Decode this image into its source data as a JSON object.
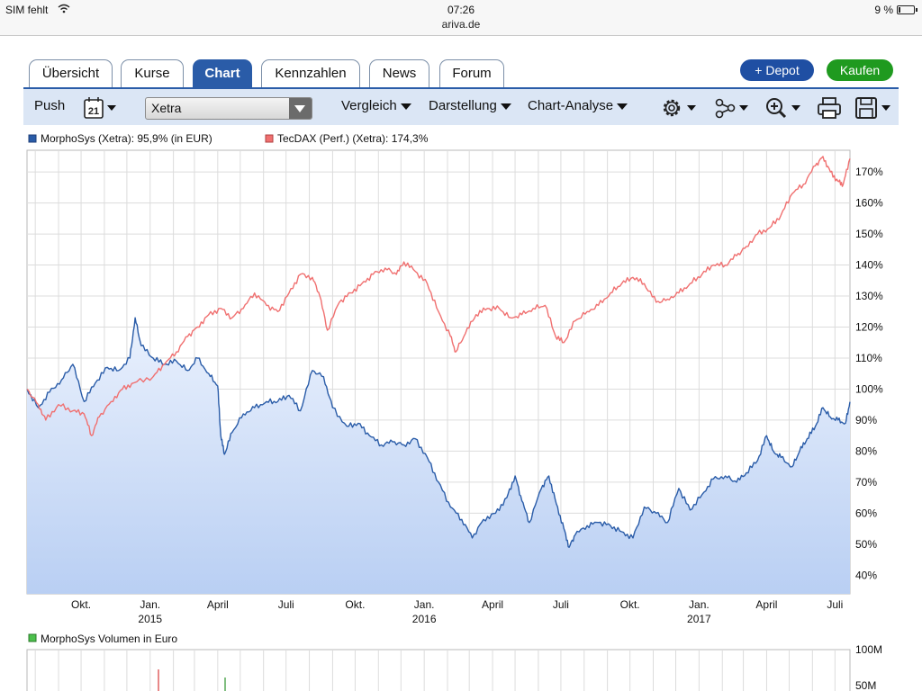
{
  "status_bar": {
    "carrier": "SIM fehlt",
    "time": "07:26",
    "url": "ariva.de",
    "battery_pct": "9 %",
    "battery_level": 0.09
  },
  "tabs": [
    {
      "label": "Übersicht",
      "active": false
    },
    {
      "label": "Kurse",
      "active": false
    },
    {
      "label": "Chart",
      "active": true
    },
    {
      "label": "Kennzahlen",
      "active": false
    },
    {
      "label": "News",
      "active": false
    },
    {
      "label": "Forum",
      "active": false
    }
  ],
  "actions": {
    "depot": "+ Depot",
    "kaufen": "Kaufen"
  },
  "toolbar": {
    "push": "Push",
    "calendar_day": "21",
    "exchange_select": "Xetra",
    "vergleich": "Vergleich",
    "darstellung": "Darstellung",
    "chart_analyse": "Chart-Analyse",
    "icons": [
      "gear-icon",
      "share-icon",
      "zoom-icon",
      "print-icon",
      "save-icon"
    ]
  },
  "chart_data": {
    "type": "area",
    "legend": [
      {
        "label": "MorphoSys (Xetra): 95,9% (in EUR)",
        "color": "#2a5ca8"
      },
      {
        "label": "TecDAX (Perf.) (Xetra): 174,3%",
        "color": "#f07070"
      }
    ],
    "y_ticks": [
      "170%",
      "160%",
      "150%",
      "140%",
      "130%",
      "120%",
      "110%",
      "100%",
      "90%",
      "80%",
      "70%",
      "60%",
      "50%",
      "40%"
    ],
    "ylim": [
      34,
      177
    ],
    "x_months": [
      {
        "label": "Okt.",
        "year": ""
      },
      {
        "label": "Jan.",
        "year": "2015"
      },
      {
        "label": "April",
        "year": ""
      },
      {
        "label": "Juli",
        "year": ""
      },
      {
        "label": "Okt.",
        "year": ""
      },
      {
        "label": "Jan.",
        "year": "2016"
      },
      {
        "label": "April",
        "year": ""
      },
      {
        "label": "Juli",
        "year": ""
      },
      {
        "label": "Okt.",
        "year": ""
      },
      {
        "label": "Jan.",
        "year": "2017"
      },
      {
        "label": "April",
        "year": ""
      },
      {
        "label": "Juli",
        "year": ""
      }
    ],
    "x_range": [
      "2014-07-21",
      "2017-07-21"
    ],
    "series": [
      {
        "name": "MorphoSys (Xetra)",
        "color": "#2a5ca8",
        "fill": true,
        "points": [
          [
            "2014-07-21",
            100
          ],
          [
            "2014-08-05",
            94
          ],
          [
            "2014-08-20",
            99
          ],
          [
            "2014-09-05",
            103
          ],
          [
            "2014-09-20",
            108
          ],
          [
            "2014-10-05",
            96
          ],
          [
            "2014-10-20",
            102
          ],
          [
            "2014-11-05",
            107
          ],
          [
            "2014-11-20",
            106
          ],
          [
            "2014-12-05",
            110
          ],
          [
            "2014-12-12",
            123
          ],
          [
            "2014-12-20",
            114
          ],
          [
            "2015-01-05",
            110
          ],
          [
            "2015-01-20",
            108
          ],
          [
            "2015-02-05",
            109
          ],
          [
            "2015-02-20",
            106
          ],
          [
            "2015-03-05",
            110
          ],
          [
            "2015-03-20",
            105
          ],
          [
            "2015-04-01",
            101
          ],
          [
            "2015-04-05",
            85
          ],
          [
            "2015-04-10",
            79
          ],
          [
            "2015-04-20",
            86
          ],
          [
            "2015-05-05",
            92
          ],
          [
            "2015-05-20",
            94
          ],
          [
            "2015-06-05",
            96
          ],
          [
            "2015-06-20",
            96
          ],
          [
            "2015-07-05",
            98
          ],
          [
            "2015-07-20",
            93
          ],
          [
            "2015-08-05",
            106
          ],
          [
            "2015-08-20",
            104
          ],
          [
            "2015-09-01",
            94
          ],
          [
            "2015-09-20",
            88
          ],
          [
            "2015-10-05",
            89
          ],
          [
            "2015-10-20",
            85
          ],
          [
            "2015-11-05",
            82
          ],
          [
            "2015-11-20",
            83
          ],
          [
            "2015-12-05",
            82
          ],
          [
            "2015-12-20",
            84
          ],
          [
            "2016-01-05",
            78
          ],
          [
            "2016-01-20",
            70
          ],
          [
            "2016-02-05",
            62
          ],
          [
            "2016-02-20",
            58
          ],
          [
            "2016-03-05",
            52
          ],
          [
            "2016-03-20",
            58
          ],
          [
            "2016-04-05",
            60
          ],
          [
            "2016-04-20",
            65
          ],
          [
            "2016-05-01",
            72
          ],
          [
            "2016-05-10",
            64
          ],
          [
            "2016-05-20",
            57
          ],
          [
            "2016-06-05",
            68
          ],
          [
            "2016-06-15",
            72
          ],
          [
            "2016-06-25",
            63
          ],
          [
            "2016-07-05",
            55
          ],
          [
            "2016-07-12",
            49
          ],
          [
            "2016-07-20",
            53
          ],
          [
            "2016-08-05",
            56
          ],
          [
            "2016-08-20",
            57
          ],
          [
            "2016-09-05",
            56
          ],
          [
            "2016-09-20",
            54
          ],
          [
            "2016-10-05",
            52
          ],
          [
            "2016-10-20",
            62
          ],
          [
            "2016-11-05",
            60
          ],
          [
            "2016-11-20",
            57
          ],
          [
            "2016-12-05",
            68
          ],
          [
            "2016-12-20",
            61
          ],
          [
            "2017-01-05",
            66
          ],
          [
            "2017-01-20",
            71
          ],
          [
            "2017-02-05",
            72
          ],
          [
            "2017-02-20",
            70
          ],
          [
            "2017-03-05",
            73
          ],
          [
            "2017-03-20",
            77
          ],
          [
            "2017-04-01",
            85
          ],
          [
            "2017-04-10",
            80
          ],
          [
            "2017-04-20",
            78
          ],
          [
            "2017-05-05",
            75
          ],
          [
            "2017-05-15",
            80
          ],
          [
            "2017-05-25",
            84
          ],
          [
            "2017-06-05",
            88
          ],
          [
            "2017-06-15",
            94
          ],
          [
            "2017-06-25",
            91
          ],
          [
            "2017-07-05",
            90
          ],
          [
            "2017-07-15",
            89
          ],
          [
            "2017-07-21",
            95.9
          ]
        ]
      },
      {
        "name": "TecDAX (Perf.) (Xetra)",
        "color": "#f07070",
        "fill": false,
        "points": [
          [
            "2014-07-21",
            100
          ],
          [
            "2014-08-05",
            95
          ],
          [
            "2014-08-15",
            90
          ],
          [
            "2014-09-01",
            95
          ],
          [
            "2014-09-20",
            93
          ],
          [
            "2014-10-05",
            92
          ],
          [
            "2014-10-15",
            85
          ],
          [
            "2014-10-25",
            91
          ],
          [
            "2014-11-10",
            96
          ],
          [
            "2014-11-25",
            100
          ],
          [
            "2014-12-10",
            102
          ],
          [
            "2015-01-05",
            104
          ],
          [
            "2015-01-20",
            108
          ],
          [
            "2015-02-05",
            112
          ],
          [
            "2015-02-20",
            117
          ],
          [
            "2015-03-05",
            120
          ],
          [
            "2015-03-20",
            124
          ],
          [
            "2015-04-05",
            126
          ],
          [
            "2015-04-20",
            123
          ],
          [
            "2015-05-05",
            126
          ],
          [
            "2015-05-20",
            131
          ],
          [
            "2015-06-05",
            127
          ],
          [
            "2015-06-20",
            125
          ],
          [
            "2015-07-05",
            131
          ],
          [
            "2015-07-20",
            137
          ],
          [
            "2015-08-05",
            136
          ],
          [
            "2015-08-15",
            130
          ],
          [
            "2015-08-25",
            119
          ],
          [
            "2015-09-10",
            128
          ],
          [
            "2015-09-25",
            131
          ],
          [
            "2015-10-10",
            134
          ],
          [
            "2015-10-25",
            137
          ],
          [
            "2015-11-10",
            139
          ],
          [
            "2015-11-25",
            137
          ],
          [
            "2015-12-05",
            141
          ],
          [
            "2015-12-20",
            138
          ],
          [
            "2016-01-05",
            134
          ],
          [
            "2016-01-20",
            125
          ],
          [
            "2016-02-05",
            117
          ],
          [
            "2016-02-12",
            112
          ],
          [
            "2016-02-25",
            118
          ],
          [
            "2016-03-10",
            124
          ],
          [
            "2016-03-25",
            126
          ],
          [
            "2016-04-10",
            126
          ],
          [
            "2016-04-25",
            123
          ],
          [
            "2016-05-10",
            124
          ],
          [
            "2016-05-25",
            126
          ],
          [
            "2016-06-10",
            127
          ],
          [
            "2016-06-24",
            117
          ],
          [
            "2016-07-05",
            115
          ],
          [
            "2016-07-20",
            122
          ],
          [
            "2016-08-05",
            125
          ],
          [
            "2016-08-20",
            127
          ],
          [
            "2016-09-05",
            131
          ],
          [
            "2016-09-20",
            134
          ],
          [
            "2016-10-05",
            136
          ],
          [
            "2016-10-20",
            134
          ],
          [
            "2016-11-05",
            128
          ],
          [
            "2016-11-20",
            129
          ],
          [
            "2016-12-05",
            131
          ],
          [
            "2016-12-20",
            134
          ],
          [
            "2017-01-05",
            137
          ],
          [
            "2017-01-20",
            140
          ],
          [
            "2017-02-05",
            140
          ],
          [
            "2017-02-20",
            143
          ],
          [
            "2017-03-05",
            146
          ],
          [
            "2017-03-20",
            150
          ],
          [
            "2017-04-05",
            152
          ],
          [
            "2017-04-20",
            156
          ],
          [
            "2017-05-05",
            163
          ],
          [
            "2017-05-20",
            166
          ],
          [
            "2017-06-05",
            172
          ],
          [
            "2017-06-15",
            175
          ],
          [
            "2017-06-25",
            170
          ],
          [
            "2017-07-05",
            167
          ],
          [
            "2017-07-12",
            166
          ],
          [
            "2017-07-21",
            174.3
          ]
        ]
      }
    ],
    "volume_panel": {
      "legend": {
        "label": "MorphoSys Volumen in Euro",
        "color": "#4cc04c"
      },
      "y_ticks": [
        "100M",
        "50M"
      ]
    }
  }
}
